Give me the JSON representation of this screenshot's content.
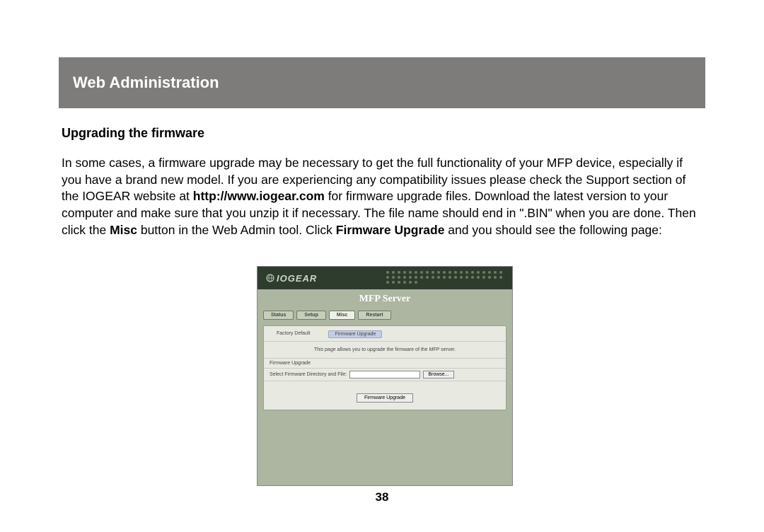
{
  "header": {
    "title": "Web Administration"
  },
  "subheading": "Upgrading the firmware",
  "paragraph": {
    "p1": "In some cases, a firmware upgrade may be necessary to get the full functionality of your MFP device, especially if you have a brand new model.  If you are experiencing any compatibility issues please check the Support section of the IOGEAR website at ",
    "url": "http://www.iogear.com",
    "p2": " for firmware upgrade files.  Download the latest version to your computer and make sure that you unzip it if necessary.  The file name should end in \".BIN\" when you are done.  Then click the ",
    "misc": "Misc",
    "p3": " button in the Web Admin tool.  Click ",
    "fwu": "Firmware Upgrade",
    "p4": " and you should see the following page:"
  },
  "screenshot": {
    "logo": "IOGEAR",
    "title": "MFP Server",
    "tabs": [
      "Status",
      "Setup",
      "Misc",
      "Restart"
    ],
    "active_tab_index": 2,
    "subtabs": [
      "Factory Default",
      "Firmware Upgrade"
    ],
    "active_subtab_index": 1,
    "desc": "This page allows you to upgrade the firmware of the MFP server.",
    "section_label": "Firmware Upgrade",
    "file_label": "Select Firmware Directory and File:",
    "browse": "Browse...",
    "submit": "Firmware Upgrade"
  },
  "page_number": "38"
}
